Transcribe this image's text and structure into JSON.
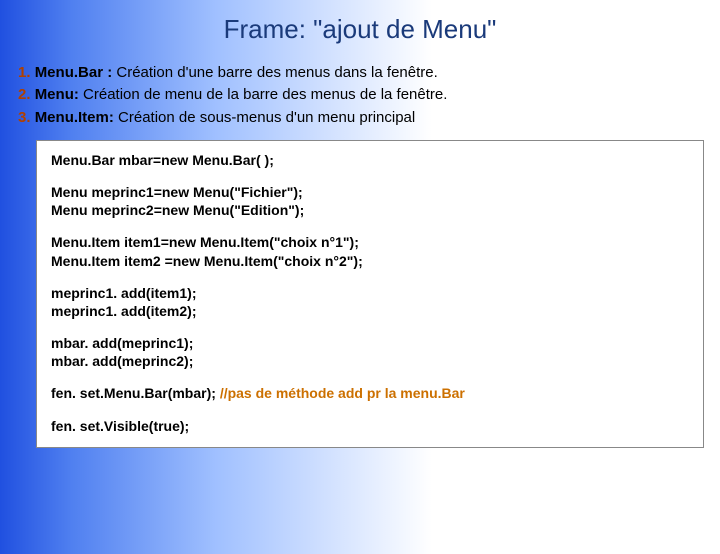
{
  "title": "Frame: \"ajout de Menu\"",
  "list": [
    {
      "num": "1.",
      "term": "Menu.Bar :",
      "desc": " Création d'une barre des menus dans la fenêtre."
    },
    {
      "num": "2.",
      "term": "Menu:",
      "desc": " Création de menu de la barre des menus de la fenêtre."
    },
    {
      "num": "3.",
      "term": "Menu.Item:",
      "desc": " Création de sous-menus d'un menu principal"
    }
  ],
  "code": {
    "g1": {
      "l1": "Menu.Bar mbar=new Menu.Bar( );"
    },
    "g2": {
      "l1": "Menu meprinc1=new Menu(\"Fichier\");",
      "l2": "Menu meprinc2=new Menu(\"Edition\");"
    },
    "g3": {
      "l1": "Menu.Item item1=new Menu.Item(\"choix n°1\");",
      "l2": "Menu.Item item2 =new Menu.Item(\"choix n°2\");"
    },
    "g4": {
      "l1": "meprinc1. add(item1);",
      "l2": "meprinc1. add(item2);"
    },
    "g5": {
      "l1": "mbar. add(meprinc1);",
      "l2": "mbar. add(meprinc2);"
    },
    "g6": {
      "main": "fen. set.Menu.Bar(mbar); ",
      "comment": "//pas de méthode add pr la menu.Bar"
    },
    "g7": {
      "l1": "fen. set.Visible(true);"
    }
  }
}
